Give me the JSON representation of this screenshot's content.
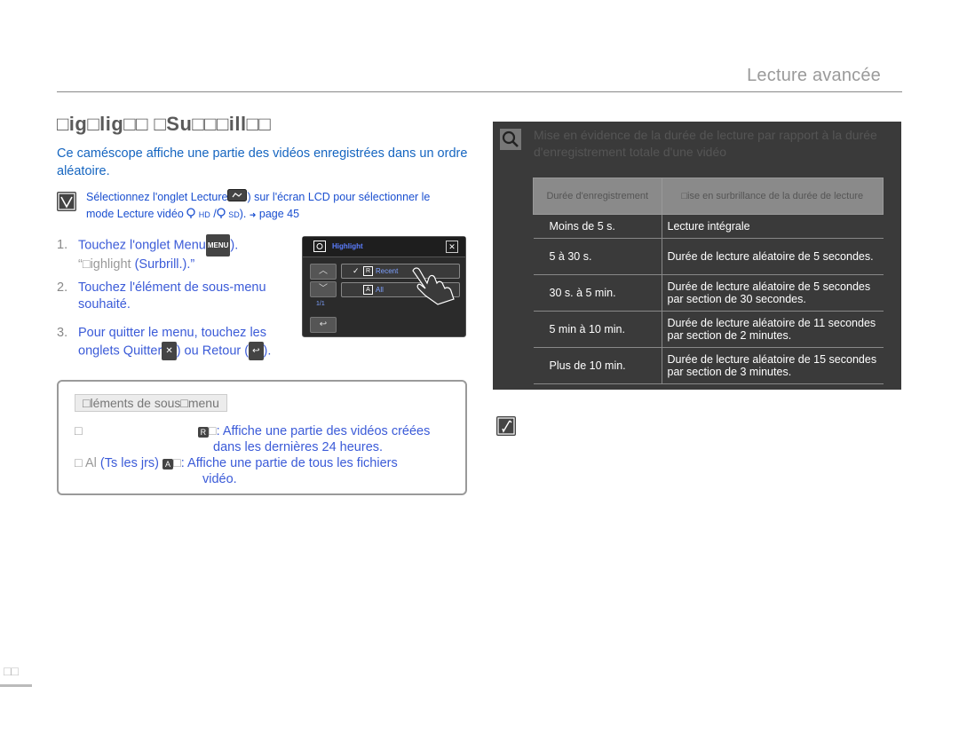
{
  "header": {
    "title": "Lecture avancée"
  },
  "section": {
    "title": "□ig□lig□□ □Su□□□ill□□",
    "intro": "Ce caméscope affiche une partie des vidéos enregistrées dans un ordre aléatoire."
  },
  "note": {
    "line1_a": "Sélectionnez l'onglet Lecture",
    "line1_b": ") sur l'écran LCD pour sélectionner le",
    "line2_a": "mode Lecture vidéo",
    "line2_hd": "HD",
    "line2_sd": "SD",
    "line2_b": ").",
    "line2_page": "page 45"
  },
  "steps": [
    {
      "num": "1.",
      "text_a": "Touchez l'onglet Menu",
      "menu": "MENU",
      "text_b": ").",
      "line2_gray": "“□ighlight",
      "line2_b": " (Surbrill.).”"
    },
    {
      "num": "2.",
      "text_a": "Touchez l'élément de sous-menu",
      "line2": "souhaité."
    },
    {
      "num": "3.",
      "text_a": "Pour quitter le menu, touchez les",
      "line2_a": "onglets Quitter",
      "line2_b": ") ou Retour (",
      "line2_c": ")."
    }
  ],
  "lcd": {
    "title": "Highlight",
    "item1": "Recent",
    "item2": "All",
    "badge1": "R",
    "badge2": "A",
    "page": "1/1"
  },
  "submenu": {
    "heading": "□léments de sous□menu",
    "item1_prefix": "□",
    "item1_badge": "R",
    "item1_sep": "□",
    "item1_text": ": Affiche une partie des vidéos créées",
    "item1_text2": "dans les dernières 24 heures.",
    "item2_prefix": "□ Al",
    "item2_bold": "(Ts les jrs)",
    "item2_badge": "A",
    "item2_sep": "□",
    "item2_text": ": Affiche une partie de tous les fichiers",
    "item2_text2": "vidéo."
  },
  "panel": {
    "title": "Mise en évidence de la durée de lecture par rapport à la durée d'enregistrement totale d'une vidéo",
    "headers": [
      "Durée d'enregistrement",
      "□ise en surbrillance de la durée de lecture"
    ],
    "rows": [
      [
        "Moins de 5 s.",
        "Lecture intégrale"
      ],
      [
        "5 à 30 s.",
        "Durée de lecture aléatoire de 5 secondes."
      ],
      [
        "30 s. à 5 min.",
        "Durée de lecture aléatoire de 5 secondes par section de 30 secondes."
      ],
      [
        "5 min à 10 min.",
        "Durée de lecture aléatoire de 11 secondes par section de 2 minutes."
      ],
      [
        "Plus de 10 min.",
        "Durée de lecture aléatoire de 15 secondes par section de 3 minutes."
      ]
    ]
  },
  "footer": {
    "page": "□□"
  }
}
